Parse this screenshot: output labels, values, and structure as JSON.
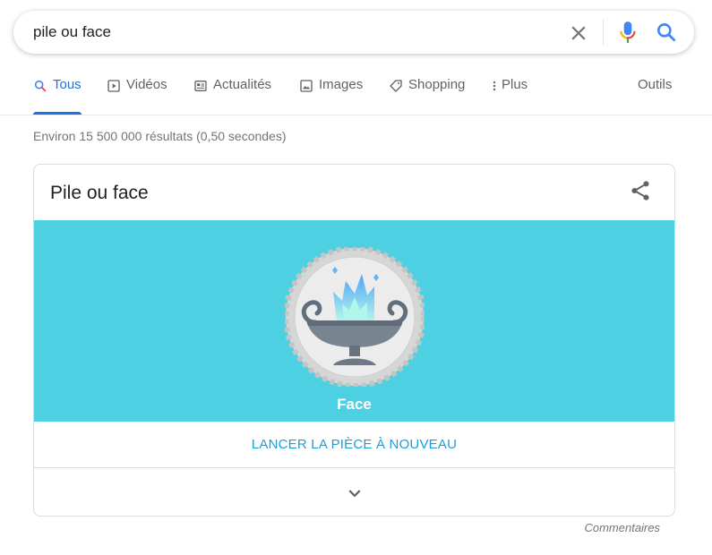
{
  "search": {
    "query": "pile ou face"
  },
  "tabs": [
    {
      "label": "Tous",
      "icon": "search-icon"
    },
    {
      "label": "Vidéos",
      "icon": "video-icon"
    },
    {
      "label": "Actualités",
      "icon": "news-icon"
    },
    {
      "label": "Images",
      "icon": "image-icon"
    },
    {
      "label": "Shopping",
      "icon": "tag-icon"
    },
    {
      "label": "Plus",
      "icon": "more-vert-icon"
    }
  ],
  "tools_label": "Outils",
  "result_stats": "Environ 15 500 000 résultats (0,50 secondes)",
  "card": {
    "title": "Pile ou face",
    "coin_result": "Face",
    "flip_label": "LANCER LA PIÈCE À NOUVEAU",
    "stage_color": "#4dd0e1"
  },
  "feedback_label": "Commentaires",
  "colors": {
    "accent": "#1a73e8",
    "link": "#1a9ed9"
  }
}
